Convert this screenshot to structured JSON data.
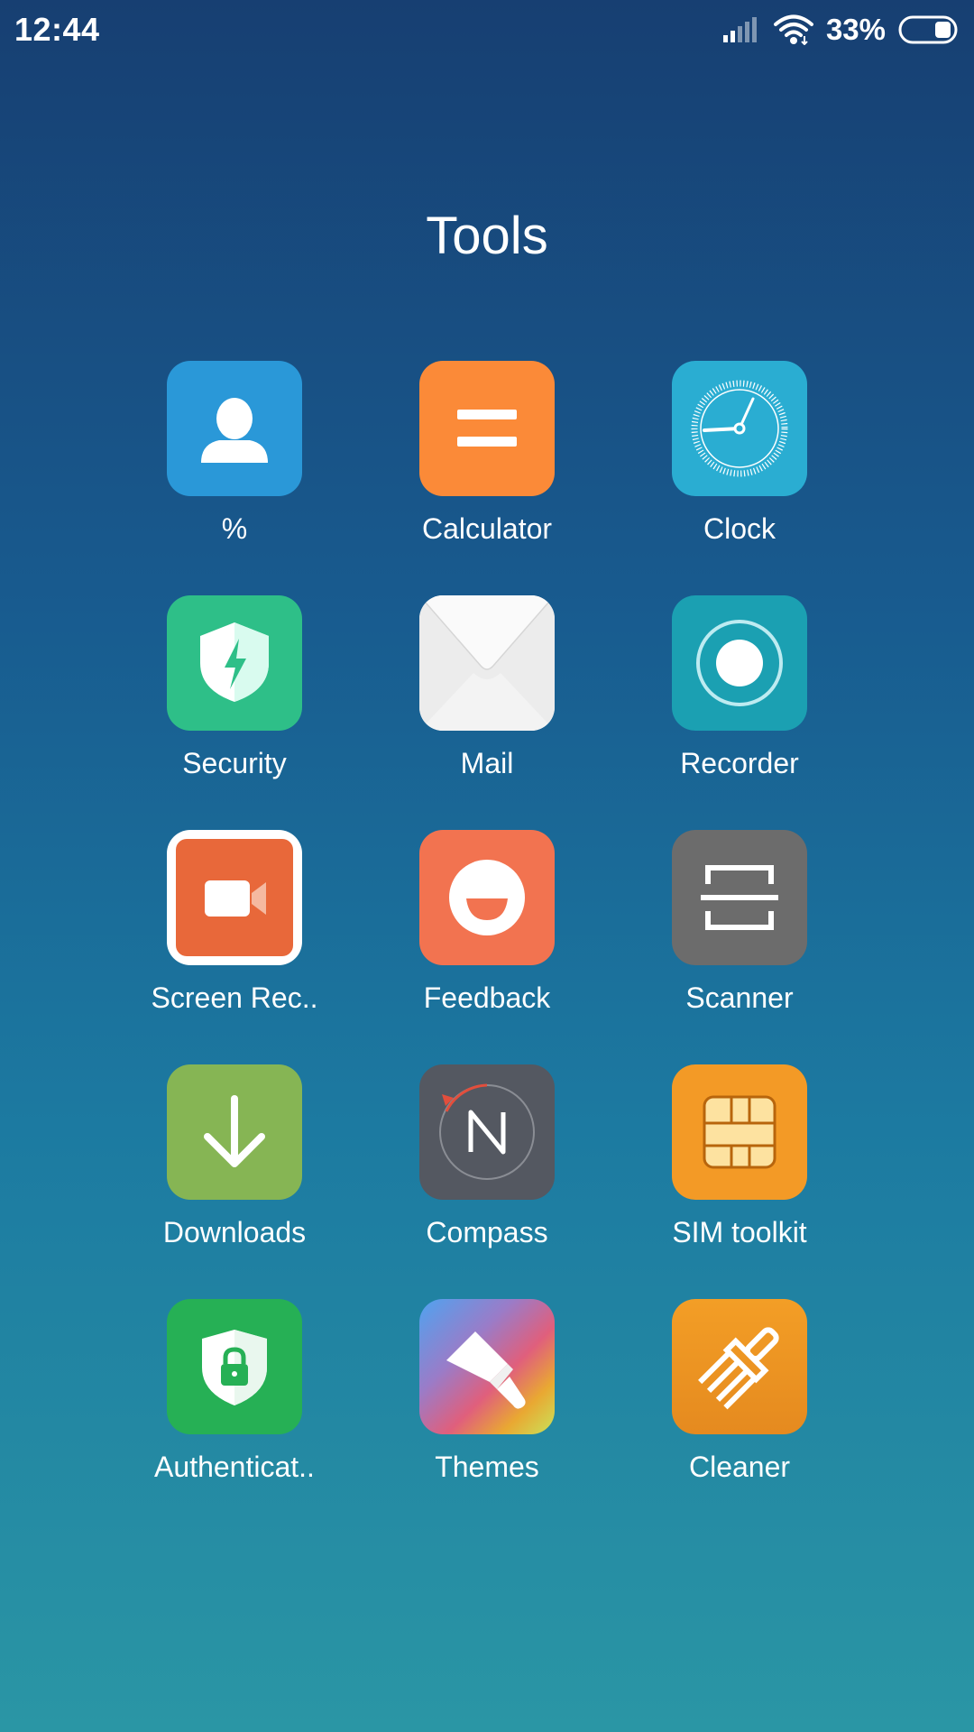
{
  "status_bar": {
    "time": "12:44",
    "battery_percent": "33%",
    "battery_level": 0.33,
    "icons": [
      "signal-icon",
      "wifi-icon",
      "battery-icon"
    ]
  },
  "folder": {
    "title": "Tools"
  },
  "apps": [
    {
      "label": "%",
      "icon": "contacts-icon"
    },
    {
      "label": "Calculator",
      "icon": "calculator-icon"
    },
    {
      "label": "Clock",
      "icon": "clock-icon"
    },
    {
      "label": "Security",
      "icon": "security-shield-icon"
    },
    {
      "label": "Mail",
      "icon": "mail-envelope-icon"
    },
    {
      "label": "Recorder",
      "icon": "recorder-icon"
    },
    {
      "label": "Screen Rec..",
      "icon": "screen-recorder-icon"
    },
    {
      "label": "Feedback",
      "icon": "feedback-smile-icon"
    },
    {
      "label": "Scanner",
      "icon": "scanner-icon"
    },
    {
      "label": "Downloads",
      "icon": "download-arrow-icon"
    },
    {
      "label": "Compass",
      "icon": "compass-icon"
    },
    {
      "label": "SIM toolkit",
      "icon": "sim-card-icon"
    },
    {
      "label": "Authenticat..",
      "icon": "authenticator-lock-icon"
    },
    {
      "label": "Themes",
      "icon": "themes-brush-icon"
    },
    {
      "label": "Cleaner",
      "icon": "cleaner-brush-icon"
    }
  ]
}
